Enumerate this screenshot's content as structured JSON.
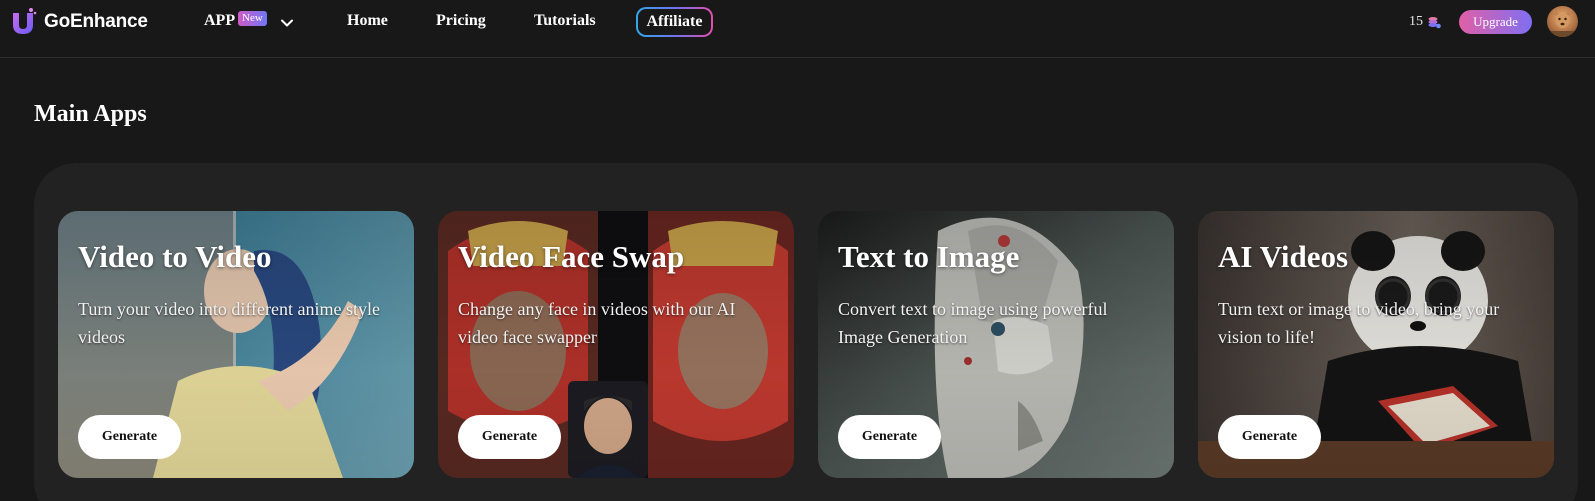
{
  "brand": {
    "name": "GoEnhance"
  },
  "nav": {
    "app_label": "APP",
    "app_badge": "New",
    "links": [
      "Home",
      "Pricing",
      "Tutorials"
    ],
    "affiliate": "Affiliate",
    "credits": "15",
    "upgrade": "Upgrade"
  },
  "section": {
    "title": "Main Apps"
  },
  "cards": [
    {
      "title": "Video to Video",
      "desc": "Turn your video into different anime style videos",
      "button": "Generate"
    },
    {
      "title": "Video Face Swap",
      "desc": "Change any face in videos with our AI video face swapper",
      "button": "Generate"
    },
    {
      "title": "Text to Image",
      "desc": "Convert text to image using powerful Image Generation",
      "button": "Generate"
    },
    {
      "title": "AI Videos",
      "desc": "Turn text or image to video, bring your vision to life!",
      "button": "Generate"
    }
  ],
  "colors": {
    "background": "#181818",
    "panel": "#222222",
    "accent_pink": "#e15fa6",
    "accent_violet": "#7f6ff1",
    "accent_blue": "#2fa7e8"
  },
  "icons": [
    "logo-icon",
    "chevron-down-icon",
    "coin-stack-icon",
    "avatar"
  ]
}
